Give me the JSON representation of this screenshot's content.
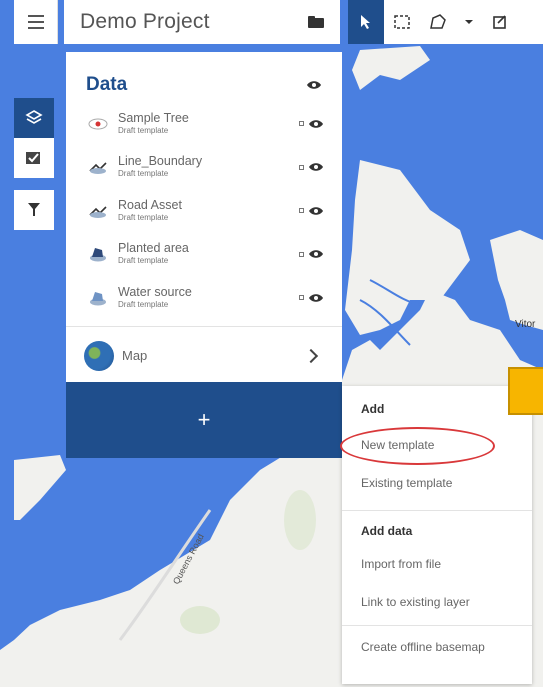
{
  "header": {
    "project_title": "Demo Project"
  },
  "panel": {
    "title": "Data",
    "layers": [
      {
        "name": "Sample Tree",
        "subtitle": "Draft template",
        "icon": "tree-point-icon"
      },
      {
        "name": "Line_Boundary",
        "subtitle": "Draft template",
        "icon": "line-icon"
      },
      {
        "name": "Road Asset",
        "subtitle": "Draft template",
        "icon": "line-icon"
      },
      {
        "name": "Planted area",
        "subtitle": "Draft template",
        "icon": "polygon-icon"
      },
      {
        "name": "Water source",
        "subtitle": "Draft template",
        "icon": "polygon-icon"
      }
    ],
    "map_label": "Map",
    "add_label": "+"
  },
  "menu": {
    "add_heading": "Add",
    "new_template": "New template",
    "existing_template": "Existing template",
    "add_data_heading": "Add data",
    "import_from_file": "Import from file",
    "link_existing_layer": "Link to existing layer",
    "create_offline_basemap": "Create offline basemap"
  },
  "map": {
    "road_label": "Queens Road",
    "place_label": "Vitor"
  },
  "colors": {
    "accent": "#1f4e8c",
    "water": "#4a7fe0",
    "land": "#f2f2ef",
    "highlight": "#d9383a",
    "marker": "#f7b500"
  }
}
